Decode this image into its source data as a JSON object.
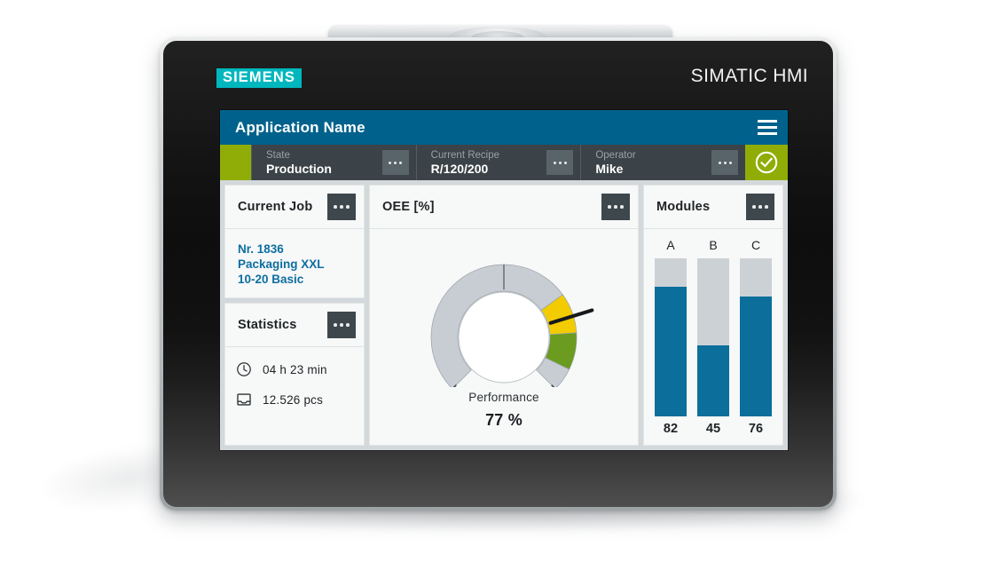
{
  "device": {
    "brand_logo": "SIEMENS",
    "product_label": "SIMATIC HMI"
  },
  "titlebar": {
    "app_title": "Application Name",
    "menu_icon": "hamburger-menu-icon"
  },
  "statusbar": {
    "accent_color": "#8fad06",
    "background_color": "#3b4348",
    "tiles": [
      {
        "label": "State",
        "value": "Production",
        "more_icon": "ellipsis-icon"
      },
      {
        "label": "Current Recipe",
        "value": "R/120/200",
        "more_icon": "ellipsis-icon"
      },
      {
        "label": "Operator",
        "value": "Mike",
        "more_icon": "ellipsis-icon"
      }
    ],
    "ok_indicator": {
      "icon": "check-circle-icon",
      "color": "#8fad06"
    }
  },
  "cards": {
    "current_job": {
      "title": "Current Job",
      "more_icon": "ellipsis-icon",
      "lines": [
        "Nr. 1836",
        "Packaging XXL",
        "10-20 Basic"
      ],
      "text_color": "#0e6fa0"
    },
    "statistics": {
      "title": "Statistics",
      "more_icon": "ellipsis-icon",
      "rows": [
        {
          "icon": "clock-icon",
          "text": "04 h   23 min"
        },
        {
          "icon": "tray-icon",
          "text": "12.526 pcs"
        }
      ]
    },
    "oee": {
      "title": "OEE [%]",
      "more_icon": "ellipsis-icon",
      "caption": "Performance",
      "value_text": "77 %"
    },
    "modules": {
      "title": "Modules",
      "more_icon": "ellipsis-icon"
    }
  },
  "chart_data": [
    {
      "type": "gauge",
      "title": "OEE [%]",
      "label": "Performance",
      "value": 77,
      "value_text": "77 %",
      "unit": "%",
      "range": [
        0,
        100
      ],
      "start_angle_deg": -225,
      "end_angle_deg": 45,
      "needle_value": 77,
      "track_color": "#c7cdd3",
      "segments": [
        {
          "from": 0,
          "to": 70,
          "color": "#c7cdd3",
          "name": "inactive"
        },
        {
          "from": 70,
          "to": 82,
          "color": "#f2cc00",
          "name": "warning"
        },
        {
          "from": 82,
          "to": 93,
          "color": "#6b9b1f",
          "name": "good"
        },
        {
          "from": 93,
          "to": 100,
          "color": "#c7cdd3",
          "name": "inactive-top"
        }
      ],
      "tick_values": [
        0,
        50,
        100
      ],
      "grid": false,
      "legend": "none"
    },
    {
      "type": "bar",
      "title": "Modules",
      "categories": [
        "A",
        "B",
        "C"
      ],
      "values": [
        82,
        45,
        76
      ],
      "ylim": [
        0,
        100
      ],
      "xlabel": "",
      "ylabel": "",
      "bar_color": "#0b6e9b",
      "track_color": "#ccd1d6",
      "grid": false,
      "legend": "none",
      "orientation": "vertical"
    }
  ]
}
